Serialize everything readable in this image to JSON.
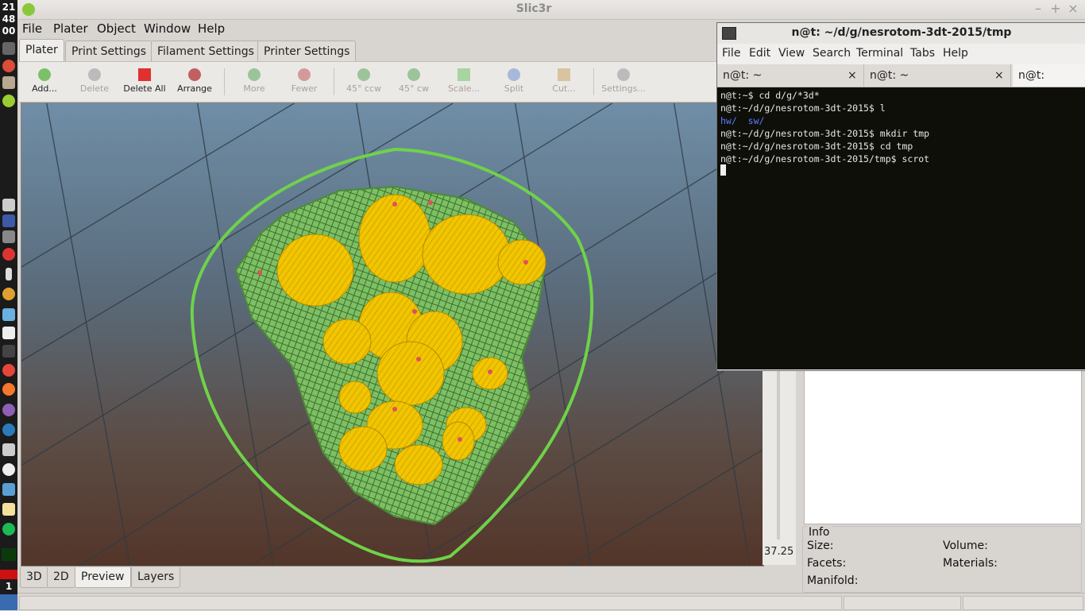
{
  "clock": {
    "hour": "21",
    "minute": "48",
    "second": "00"
  },
  "workspace_number": "1",
  "slic3r": {
    "title": "Slic3r",
    "menu": [
      "File",
      "Plater",
      "Object",
      "Window",
      "Help"
    ],
    "tabs": [
      "Plater",
      "Print Settings",
      "Filament Settings",
      "Printer Settings"
    ],
    "toolbar": [
      {
        "label": "Add...",
        "enabled": true,
        "icon": "add-icon"
      },
      {
        "label": "Delete",
        "enabled": false,
        "icon": "delete-icon"
      },
      {
        "label": "Delete All",
        "enabled": true,
        "icon": "delete-all-icon"
      },
      {
        "label": "Arrange",
        "enabled": true,
        "icon": "arrange-icon"
      },
      {
        "label": "More",
        "enabled": false,
        "icon": "more-icon"
      },
      {
        "label": "Fewer",
        "enabled": false,
        "icon": "fewer-icon"
      },
      {
        "label": "45° ccw",
        "enabled": false,
        "icon": "rotate-ccw-icon"
      },
      {
        "label": "45° cw",
        "enabled": false,
        "icon": "rotate-cw-icon"
      },
      {
        "label": "Scale...",
        "enabled": false,
        "icon": "scale-icon"
      },
      {
        "label": "Split",
        "enabled": false,
        "icon": "split-icon"
      },
      {
        "label": "Cut...",
        "enabled": false,
        "icon": "cut-icon"
      },
      {
        "label": "Settings...",
        "enabled": false,
        "icon": "settings-icon"
      }
    ],
    "z_value": "37.25",
    "view_tabs": [
      "3D",
      "2D",
      "Preview",
      "Layers"
    ],
    "active_view_tab": "Preview",
    "info": {
      "heading": "Info",
      "size_label": "Size:",
      "volume_label": "Volume:",
      "facets_label": "Facets:",
      "materials_label": "Materials:",
      "manifold_label": "Manifold:"
    },
    "colors": {
      "perimeter": "#76c85e",
      "infill": "#f1c500",
      "skirt": "#6fd24a"
    }
  },
  "terminal": {
    "title": "n@t: ~/d/g/nesrotom-3dt-2015/tmp",
    "menu": [
      "File",
      "Edit",
      "View",
      "Search",
      "Terminal",
      "Tabs",
      "Help"
    ],
    "tabs": [
      "n@t: ~",
      "n@t: ~",
      "n@t: ~/d/g/n"
    ],
    "lines": [
      "n@t:~$ cd d/g/*3d*",
      "n@t:~/d/g/nesrotom-3dt-2015$ l",
      "",
      "n@t:~/d/g/nesrotom-3dt-2015$ mkdir tmp",
      "n@t:~/d/g/nesrotom-3dt-2015$ cd tmp",
      "n@t:~/d/g/nesrotom-3dt-2015/tmp$ scrot"
    ],
    "dirs": [
      "hw/",
      "sw/"
    ]
  }
}
